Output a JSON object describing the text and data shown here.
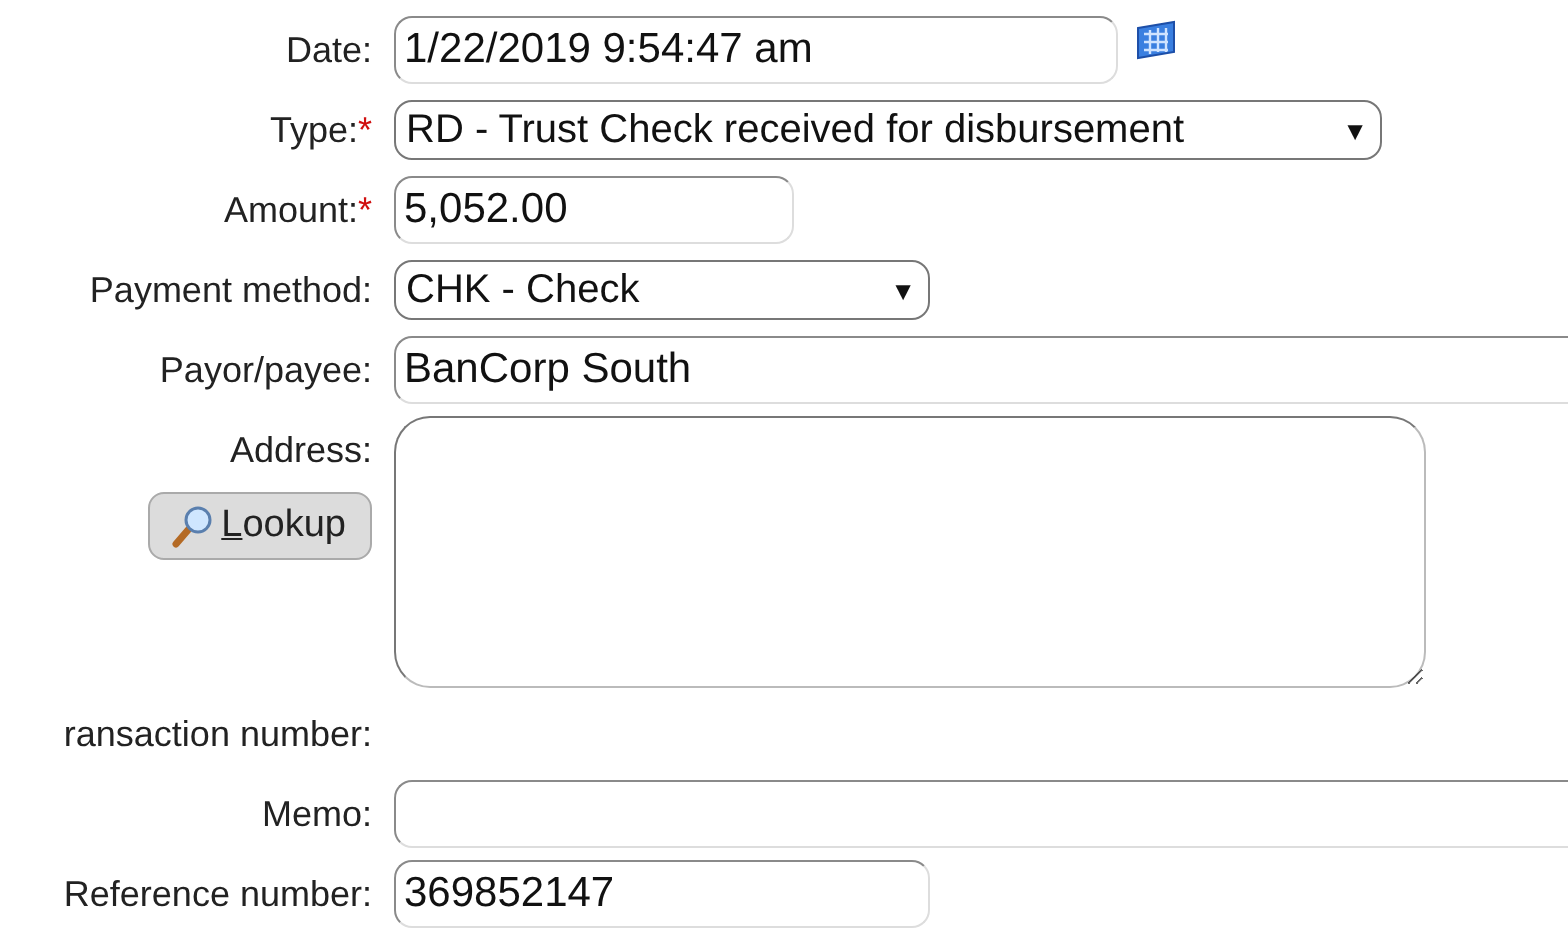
{
  "fields": [
    {
      "kind": "date",
      "label": "Date:",
      "value": "1/22/2019 9:54:47 am"
    },
    {
      "kind": "select",
      "label": "Type:",
      "required_mark": "*",
      "value": "RD - Trust Check received for disbursement",
      "arrow": "▼"
    },
    {
      "kind": "text",
      "label": "Amount:",
      "required_mark": "*",
      "value": "5,052.00"
    },
    {
      "kind": "select",
      "label": "Payment method:",
      "value": "CHK - Check",
      "arrow": "▼"
    },
    {
      "kind": "text",
      "label": "Payor/payee:",
      "value": "BanCorp South"
    },
    {
      "kind": "textarea",
      "label": "Address:",
      "button": {
        "hotkey": "L",
        "label": "ookup"
      }
    },
    {
      "kind": "none",
      "label": "ransaction number:"
    },
    {
      "kind": "text",
      "label": "Memo:"
    },
    {
      "kind": "text",
      "label": "Reference number:",
      "value": "369852147"
    }
  ]
}
